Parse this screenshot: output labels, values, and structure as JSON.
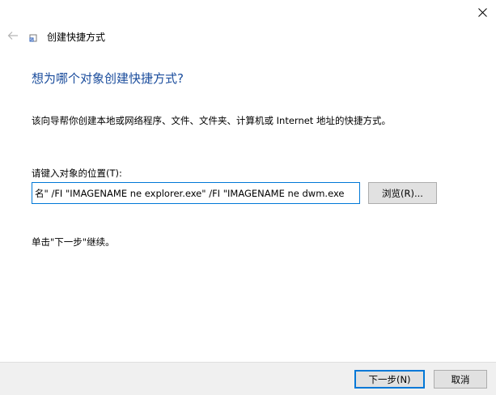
{
  "window": {
    "title": "创建快捷方式",
    "close_icon": "close-icon",
    "back_icon": "back-arrow-icon",
    "app_icon": "shortcut-icon"
  },
  "main": {
    "heading": "想为哪个对象创建快捷方式?",
    "description": "该向导帮你创建本地或网络程序、文件、文件夹、计算机或 Internet 地址的快捷方式。",
    "field_label": "请键入对象的位置(T):",
    "location_value": "名\" /FI \"IMAGENAME ne explorer.exe\" /FI \"IMAGENAME ne dwm.exe",
    "browse_label": "浏览(R)...",
    "instruction": "单击\"下一步\"继续。"
  },
  "footer": {
    "next_label": "下一步(N)",
    "cancel_label": "取消"
  },
  "colors": {
    "heading": "#1a4c9c",
    "accent": "#0078d7",
    "footer_bg": "#f0f0f0",
    "button_bg": "#e1e1e1"
  }
}
